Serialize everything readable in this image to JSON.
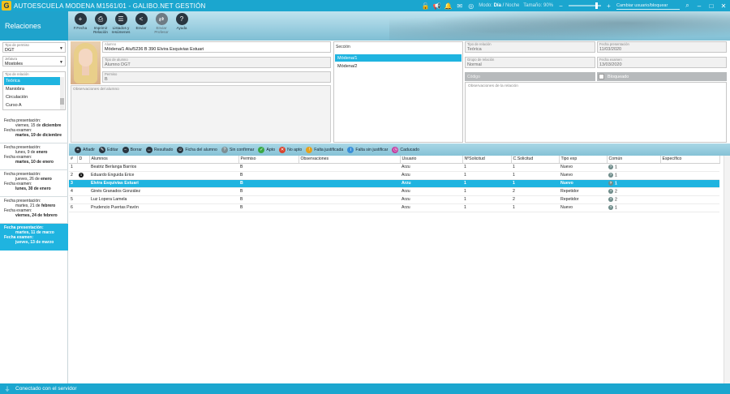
{
  "app": {
    "logo": "G",
    "title": "AUTOESCUELA MODENA  M1561/01 - GALIBO.NET GESTIÓN"
  },
  "titlebar": {
    "mode_label": "Modo:",
    "mode_day": "Día",
    "mode_sep": " / ",
    "mode_night": "Noche",
    "size_label": "Tamaño: 90%",
    "slider_percent": 90,
    "user_search": "Cambiar usuario/bloquear",
    "icons": [
      "unlock-icon",
      "megaphone-icon",
      "bell-icon",
      "message-icon",
      "globe-icon"
    ]
  },
  "section_title": "Relaciones",
  "toolbar": {
    "new": "F.Fecha",
    "print": "Imprimir Relación",
    "lists": "Listados y resúmenes",
    "send": "Enviar",
    "send_prof": "Enviar Profesor",
    "help": "Ayuda"
  },
  "sidebar": {
    "permiso_cap": "Tipo de permiso",
    "permiso_val": "DGT",
    "jefatura_cap": "Jefatura",
    "jefatura_val": "Mostoles",
    "relacion_cap": "Tipo de relación",
    "relacion_items": [
      "Teórica",
      "Maniobra",
      "Circulación",
      "Curso A"
    ],
    "dates": [
      {
        "pres_label": "Fecha presentación:",
        "pres_day": "viernes, 15 de ",
        "pres_month": "diciembre",
        "exam_label": "Fecha examen:",
        "exam_value": "martes, 19 de diciembre"
      },
      {
        "pres_label": "Fecha presentación:",
        "pres_day": "lunes, 9 de ",
        "pres_month": "enero",
        "exam_label": "Fecha examen:",
        "exam_value": "martes, 10 de enero"
      },
      {
        "pres_label": "Fecha presentación:",
        "pres_day": "jueves, 26 de ",
        "pres_month": "enero",
        "exam_label": "Fecha examen:",
        "exam_value": "lunes, 30 de enero"
      },
      {
        "pres_label": "Fecha presentación:",
        "pres_day": "martes, 21 de ",
        "pres_month": "febrero",
        "exam_label": "Fecha examen:",
        "exam_value": "viernes, 24 de febrero"
      },
      {
        "pres_label": "Fecha presentación:",
        "pres_day": "martes, 11 de ",
        "pres_month": "marzo",
        "exam_label": "Fecha examen:",
        "exam_value": "jueves, 13 de marzo"
      }
    ]
  },
  "detail": {
    "alumno_cap": "Alumno",
    "alumno_val": "Módena/1 Alu/5236 B 390 Elvira Esquivias Estuari",
    "tipo_alumno_cap": "Tipo de alumno",
    "tipo_alumno_val": "Alumno DGT",
    "permiso_cap": "Permiso",
    "permiso_val": "B",
    "obs_alumno_cap": "Observaciones del alumno",
    "seccion_cap": "Sección",
    "seccion_items": [
      "Módena/1",
      "Módena/2"
    ],
    "tipo_rel_cap": "Tipo de relación",
    "tipo_rel_val": "Teórica",
    "grupo_cap": "Grupo de relación",
    "grupo_val": "Normal",
    "fecha_pres_cap": "Fecha presentación",
    "fecha_pres_val": "11/03/2020",
    "fecha_exam_cap": "Fecha examen",
    "fecha_exam_val": "13/03/2020",
    "codigo_cap": "Código",
    "bloqueado": "Bloqueado",
    "obs_rel_cap": "Observaciones de la relación"
  },
  "actions": {
    "add": "Añadir",
    "edit": "Editar",
    "delete": "Borrar",
    "result": "Resultado",
    "ficha": "Ficha del alumno",
    "unconfirmed": "Sin confirmar",
    "apto": "Apto",
    "no_apto": "No apto",
    "falta_just": "Falta justificada",
    "falta_sin": "Falta sin justificar",
    "caducado": "Caducado"
  },
  "grid": {
    "headers": [
      "#",
      "D",
      "Alumnos",
      "Permiso",
      "Observaciones",
      "Usuario",
      "NºSolicitud",
      "C.Solicitud",
      "Tipo exp",
      "Común",
      "Específico"
    ],
    "rows": [
      {
        "n": "1",
        "d": "",
        "alumno": "Beatriz Berlanga Barrios",
        "permiso": "B",
        "obs": "",
        "usuario": "Arzu",
        "nsol": "1",
        "csol": "1",
        "tipo": "Nuevo",
        "comun": "1",
        "esp": ""
      },
      {
        "n": "2",
        "d": "1",
        "alumno": "Eduardo Enguida Erice",
        "permiso": "B",
        "obs": "",
        "usuario": "Arzu",
        "nsol": "1",
        "csol": "1",
        "tipo": "Nuevo",
        "comun": "1",
        "esp": ""
      },
      {
        "n": "3",
        "d": "",
        "alumno": "Elvira Esquivias Estuari",
        "permiso": "B",
        "obs": "",
        "usuario": "Arzu",
        "nsol": "1",
        "csol": "1",
        "tipo": "Nuevo",
        "comun": "1",
        "esp": ""
      },
      {
        "n": "4",
        "d": "",
        "alumno": "Ginés Granados González",
        "permiso": "B",
        "obs": "",
        "usuario": "Arzu",
        "nsol": "1",
        "csol": "2",
        "tipo": "Repetidor",
        "comun": "2",
        "esp": ""
      },
      {
        "n": "5",
        "d": "",
        "alumno": "Luz Lopera Lamela",
        "permiso": "B",
        "obs": "",
        "usuario": "Arzu",
        "nsol": "1",
        "csol": "2",
        "tipo": "Repetidor",
        "comun": "2",
        "esp": ""
      },
      {
        "n": "6",
        "d": "",
        "alumno": "Prudencio Puertas Pavón",
        "permiso": "B",
        "obs": "",
        "usuario": "Arzu",
        "nsol": "1",
        "csol": "1",
        "tipo": "Nuevo",
        "comun": "1",
        "esp": ""
      }
    ],
    "selected_row": 2
  },
  "status": {
    "text": "Conectado con el servidor"
  },
  "colors": {
    "accent": "#1ba6cf",
    "selection": "#1fb4e0"
  }
}
